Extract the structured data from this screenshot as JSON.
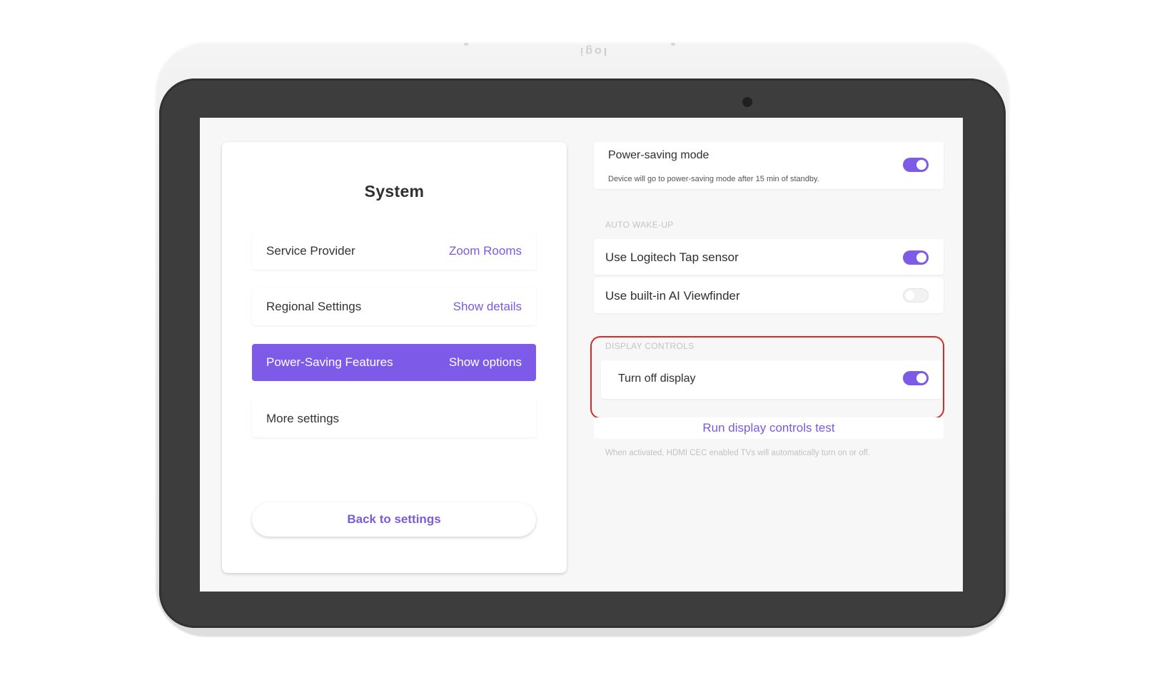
{
  "device": {
    "brand_mark": "logi",
    "colors": {
      "accent": "#7d5be8",
      "highlight_outline": "#d92a2a",
      "bezel": "#3d3d3d"
    }
  },
  "system_menu": {
    "title": "System",
    "items": [
      {
        "label": "Service Provider",
        "value": "Zoom Rooms",
        "active": false
      },
      {
        "label": "Regional Settings",
        "value": "Show details",
        "active": false
      },
      {
        "label": "Power-Saving Features",
        "value": "Show options",
        "active": true
      },
      {
        "label": "More settings",
        "value": "",
        "active": false
      }
    ],
    "back_button": "Back to settings"
  },
  "power_saving": {
    "mode": {
      "label": "Power-saving mode",
      "description": "Device will go to power-saving mode after 15 min of standby.",
      "enabled": true
    },
    "auto_wake_up": {
      "header": "AUTO WAKE-UP",
      "items": [
        {
          "label": "Use Logitech Tap sensor",
          "enabled": true
        },
        {
          "label": "Use built-in AI Viewfinder",
          "enabled": false
        }
      ]
    },
    "display_controls": {
      "header": "DISPLAY CONTROLS",
      "turn_off_display": {
        "label": "Turn off display",
        "enabled": true
      },
      "test_button": "Run display controls test",
      "footnote": "When activated, HDMI CEC enabled TVs will automatically turn on or off."
    }
  }
}
